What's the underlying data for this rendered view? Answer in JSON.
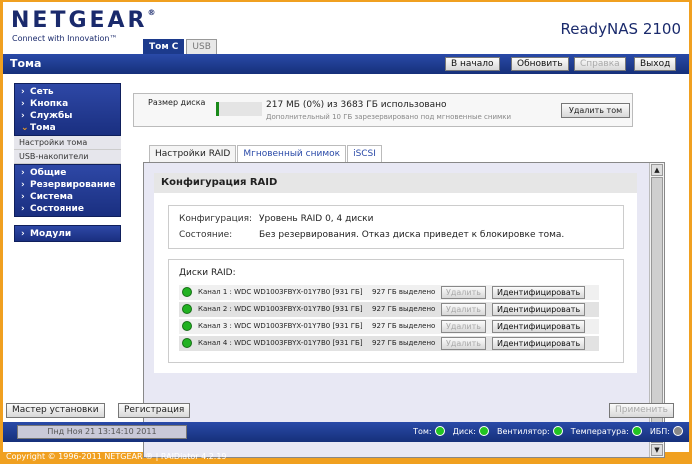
{
  "header": {
    "logo": "NETGEAR",
    "logo_tm": "®",
    "tagline": "Connect with Innovation™",
    "product": "ReadyNAS 2100",
    "tabs": [
      {
        "label": "Том C",
        "active": true
      },
      {
        "label": "USB",
        "active": false
      }
    ]
  },
  "titlebar": {
    "title": "Тома",
    "home": "В начало",
    "refresh": "Обновить",
    "help": "Справка",
    "logout": "Выход"
  },
  "sidebar": {
    "groups": [
      {
        "items": [
          "Сеть",
          "Кнопка",
          "Службы",
          "Тома"
        ]
      },
      {
        "subitems": [
          "Настройки тома",
          "USB-накопители"
        ]
      },
      {
        "items": [
          "Общие",
          "Резервирование",
          "Система",
          "Состояние"
        ]
      },
      {
        "items": [
          "Модули"
        ]
      }
    ]
  },
  "disk": {
    "label": "Размер диска",
    "usage_fraction": 0.0,
    "used_text": "217 МБ (0%) из 3683 ГБ использовано",
    "reserved_text": "Дополнительный 10 ГБ зарезервировано под мгновенные снимки",
    "delete_btn": "Удалить том"
  },
  "tabs": [
    {
      "label": "Настройки RAID",
      "active": true
    },
    {
      "label": "Мгновенный снимок",
      "active": false
    },
    {
      "label": "iSCSI",
      "active": false
    }
  ],
  "raid": {
    "title": "Конфигурация RAID",
    "config_key": "Конфигурация:",
    "config_val": "Уровень RAID 0, 4 диски",
    "state_key": "Состояние:",
    "state_val": "Без резервирования. Отказ диска приведет к блокировке тома.",
    "disks_title": "Диски RAID:",
    "disks": [
      {
        "name": "Канал 1 : WDC WD1003FBYX-01Y7B0 [931 ГБ]",
        "alloc": "927 ГБ выделено",
        "remove": "Удалить",
        "identify": "Идентифицировать"
      },
      {
        "name": "Канал 2 : WDC WD1003FBYX-01Y7B0 [931 ГБ]",
        "alloc": "927 ГБ выделено",
        "remove": "Удалить",
        "identify": "Идентифицировать"
      },
      {
        "name": "Канал 3 : WDC WD1003FBYX-01Y7B0 [931 ГБ]",
        "alloc": "927 ГБ выделено",
        "remove": "Удалить",
        "identify": "Идентифицировать"
      },
      {
        "name": "Канал 4 : WDC WD1003FBYX-01Y7B0 [931 ГБ]",
        "alloc": "927 ГБ выделено",
        "remove": "Удалить",
        "identify": "Идентифицировать"
      }
    ]
  },
  "footer": {
    "wizard": "Мастер установки",
    "register": "Регистрация",
    "apply": "Применить"
  },
  "status": {
    "datetime": "Пнд Ноя 21  13:14:10 2011",
    "items": [
      {
        "label": "Том:",
        "state": "ok"
      },
      {
        "label": "Диск:",
        "state": "ok"
      },
      {
        "label": "Вентилятор:",
        "state": "ok"
      },
      {
        "label": "Температура:",
        "state": "ok"
      },
      {
        "label": "ИБП:",
        "state": "off"
      }
    ]
  },
  "copyright": "Copyright © 1996-2011 NETGEAR ® | RAIDiator 4.2.19",
  "colors": {
    "accent": "#1c3a8c",
    "status_ok": "#22b222",
    "background": "#f0a020"
  }
}
